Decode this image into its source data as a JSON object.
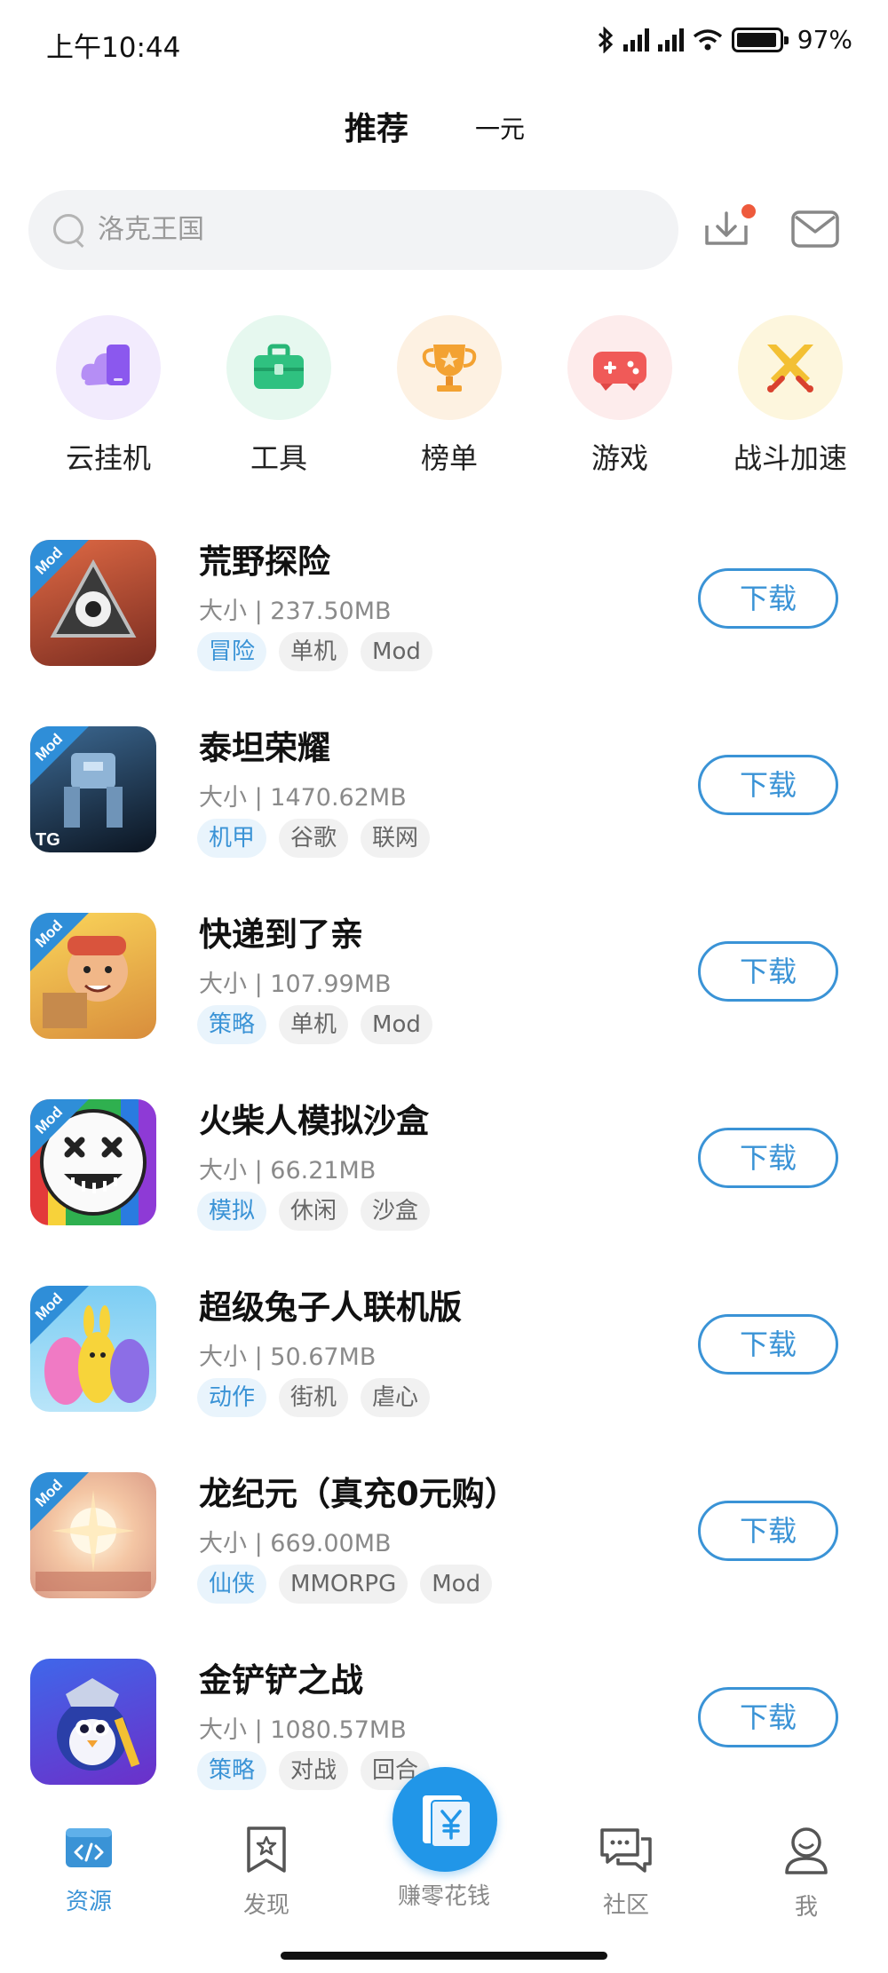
{
  "status_bar": {
    "time": "上午10:44",
    "battery": "97%",
    "battery_level": 0.97
  },
  "top_tabs": {
    "main": "推荐",
    "sub": "一元"
  },
  "search": {
    "placeholder": "洛克王国"
  },
  "categories": [
    {
      "label": "云挂机",
      "icon": "cloud-phone-icon",
      "color": "#9b6cf0"
    },
    {
      "label": "工具",
      "icon": "toolbox-icon",
      "color": "#2fc180"
    },
    {
      "label": "榜单",
      "icon": "trophy-icon",
      "color": "#f3a232"
    },
    {
      "label": "游戏",
      "icon": "gamepad-icon",
      "color": "#f05a58"
    },
    {
      "label": "战斗加速",
      "icon": "crossed-swords-icon",
      "color": "#f3c033"
    }
  ],
  "apps": [
    {
      "name": "荒野探险",
      "size": "大小 | 237.50MB",
      "tags": [
        "冒险",
        "单机",
        "Mod"
      ],
      "action": "下载",
      "badge": "Mod",
      "icon_colors": [
        "#d9533a",
        "#6a2b22"
      ]
    },
    {
      "name": "泰坦荣耀",
      "size": "大小 | 1470.62MB",
      "tags": [
        "机甲",
        "谷歌",
        "联网"
      ],
      "action": "下载",
      "badge": "Mod",
      "icon_colors": [
        "#2e4a6a",
        "#0c1622"
      ]
    },
    {
      "name": "快递到了亲",
      "size": "大小 | 107.99MB",
      "tags": [
        "策略",
        "单机",
        "Mod"
      ],
      "action": "下载",
      "badge": "Mod",
      "icon_colors": [
        "#f7c94a",
        "#c9853a"
      ]
    },
    {
      "name": "火柴人模拟沙盒",
      "size": "大小 | 66.21MB",
      "tags": [
        "模拟",
        "休闲",
        "沙盒"
      ],
      "action": "下载",
      "badge": "Mod",
      "icon_colors": [
        "#2a7be0",
        "#e0365a"
      ]
    },
    {
      "name": "超级兔子人联机版",
      "size": "大小 | 50.67MB",
      "tags": [
        "动作",
        "街机",
        "虐心"
      ],
      "action": "下载",
      "badge": "Mod",
      "icon_colors": [
        "#6fc3f0",
        "#e89ad4"
      ]
    },
    {
      "name": "龙纪元（真充0元购）",
      "size": "大小 | 669.00MB",
      "tags": [
        "仙侠",
        "MMORPG",
        "Mod"
      ],
      "action": "下载",
      "badge": "Mod",
      "icon_colors": [
        "#f7e6c8",
        "#e6b49a"
      ]
    },
    {
      "name": "金铲铲之战",
      "size": "大小 | 1080.57MB",
      "tags": [
        "策略",
        "对战",
        "回合"
      ],
      "action": "下载",
      "badge": "",
      "icon_colors": [
        "#3b5fe0",
        "#7b3fd0"
      ]
    }
  ],
  "bottom_nav": [
    {
      "label": "资源",
      "icon": "code-window-icon",
      "active": true
    },
    {
      "label": "发现",
      "icon": "star-bookmark-icon",
      "active": false
    },
    {
      "label": "赚零花钱",
      "icon": "yen-envelope-icon",
      "active": false
    },
    {
      "label": "社区",
      "icon": "chat-bubbles-icon",
      "active": false
    },
    {
      "label": "我",
      "icon": "user-profile-icon",
      "active": false
    }
  ],
  "colors": {
    "accent": "#3a93d6",
    "fab": "#2196e8",
    "tag_bg": "#f1f1f1",
    "tag_first_bg": "#e9f4fc"
  }
}
